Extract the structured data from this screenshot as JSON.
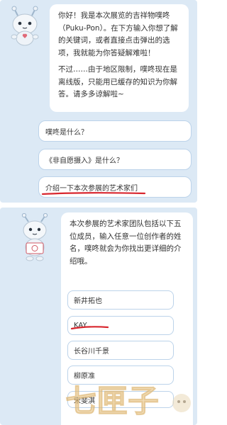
{
  "greeting_bubble": {
    "paragraph1": "你好！我是本次展览的吉祥物噗咚（Puku-Pon）。在下方输入你想了解的关键词，或者直接点击弹出的选项，我就能为你答疑解难啦！",
    "paragraph2": "不过……由于地区限制，噗咚现在是离线版，只能用已缓存的知识为你解答。请多多谅解啦~"
  },
  "options": [
    {
      "label": "噗咚是什么？"
    },
    {
      "label": "《非自愿摄入》是什么？"
    },
    {
      "label": "介绍一下本次参展的艺术家们"
    }
  ],
  "artist_bubble": {
    "text": "本次参展的艺术家团队包括以下五位成员，输入任意一位创作者的姓名，噗咚就会为你找出更详细的介绍哦。"
  },
  "artists": [
    {
      "name": "新井拓也"
    },
    {
      "name": "KAY"
    },
    {
      "name": "长谷川千景"
    },
    {
      "name": "柳原准"
    },
    {
      "name": "宋斐淇"
    }
  ],
  "watermark": {
    "text": "七匣子"
  },
  "colors": {
    "panel_bg": "#dce9f5",
    "bubble_bg": "#ffffff",
    "option_border": "#bcd3ea",
    "underline_red": "#d8262e"
  },
  "icons": [
    "mascot-avatar-icon",
    "mascot-holding-sign-icon",
    "watermark-logo-icon"
  ]
}
